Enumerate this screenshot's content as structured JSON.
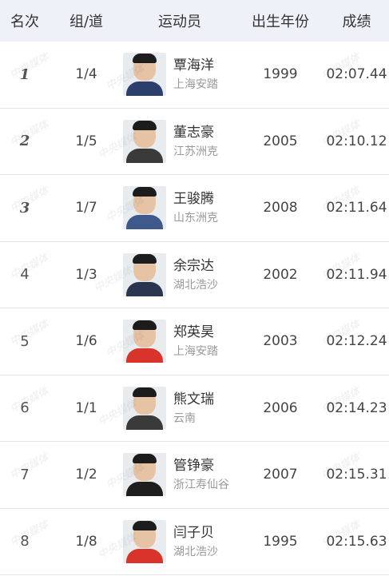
{
  "header": {
    "rank": "名次",
    "lane": "组/道",
    "athlete": "运动员",
    "birth_year": "出生年份",
    "result": "成绩"
  },
  "rows": [
    {
      "rank": "1",
      "medal": "gold",
      "lane": "1/4",
      "name": "覃海洋",
      "team": "上海安踏",
      "year": "1999",
      "result": "02:07.44",
      "shirt_color": "#2c3e6b"
    },
    {
      "rank": "2",
      "medal": "silver",
      "lane": "1/5",
      "name": "董志豪",
      "team": "江苏洲克",
      "year": "2005",
      "result": "02:10.12",
      "shirt_color": "#3a3a3a"
    },
    {
      "rank": "3",
      "medal": "bronze",
      "lane": "1/7",
      "name": "王骏腾",
      "team": "山东洲克",
      "year": "2008",
      "result": "02:11.64",
      "shirt_color": "#3d5a8a"
    },
    {
      "rank": "4",
      "medal": "",
      "lane": "1/3",
      "name": "余宗达",
      "team": "湖北浩沙",
      "year": "2002",
      "result": "02:11.94",
      "shirt_color": "#2a3550"
    },
    {
      "rank": "5",
      "medal": "",
      "lane": "1/6",
      "name": "郑英昊",
      "team": "上海安踏",
      "year": "2003",
      "result": "02:12.24",
      "shirt_color": "#d8342c"
    },
    {
      "rank": "6",
      "medal": "",
      "lane": "1/1",
      "name": "熊文瑞",
      "team": "云南",
      "year": "2006",
      "result": "02:14.23",
      "shirt_color": "#3a3a3a"
    },
    {
      "rank": "7",
      "medal": "",
      "lane": "1/2",
      "name": "管铮豪",
      "team": "浙江寿仙谷",
      "year": "2007",
      "result": "02:15.31",
      "shirt_color": "#1e1e1e"
    },
    {
      "rank": "8",
      "medal": "",
      "lane": "1/8",
      "name": "闫子贝",
      "team": "湖北浩沙",
      "year": "1995",
      "result": "02:15.63",
      "shirt_color": "#d8342c"
    }
  ],
  "watermark_text": "中央媒体"
}
